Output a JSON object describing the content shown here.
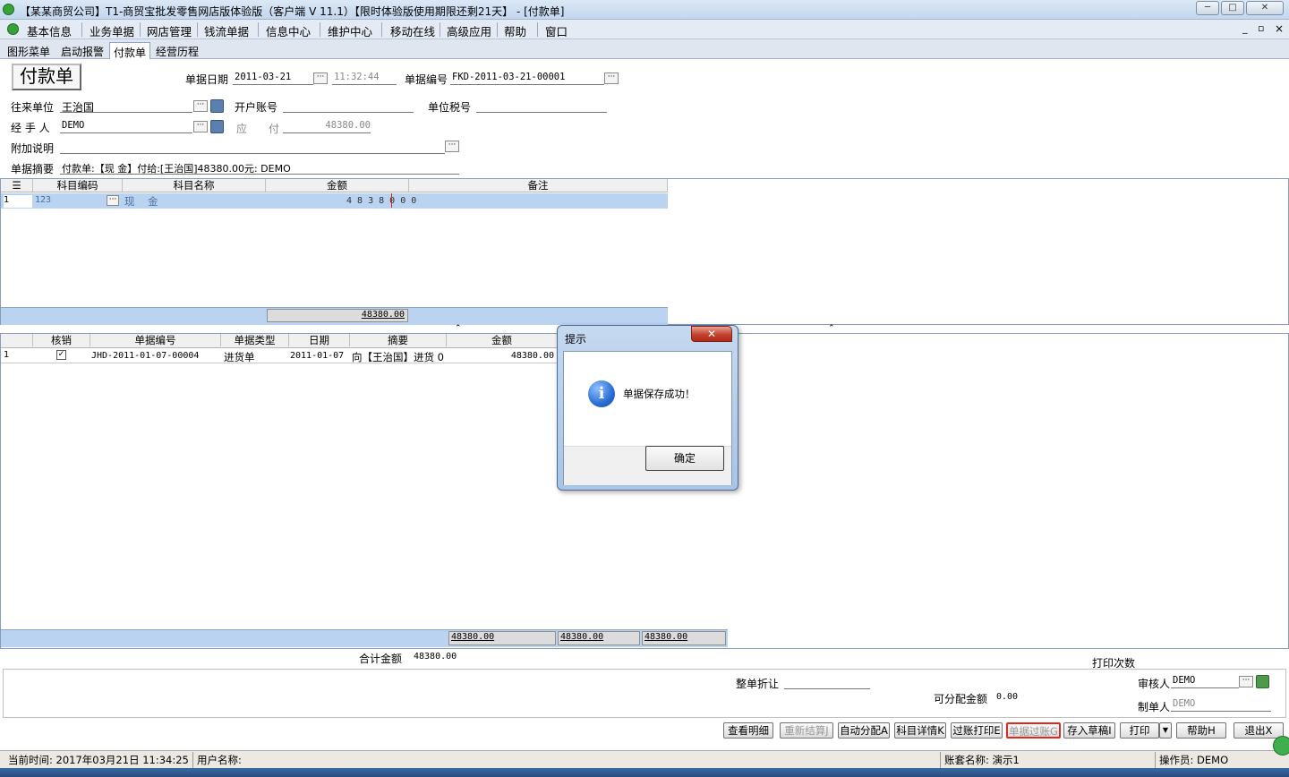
{
  "window": {
    "title": "【某某商贸公司】T1-商贸宝批发零售网店版体验版（客户端 V 11.1）【限时体验版使用期限还剩21天】 - [付款单]",
    "min_glyph": "─",
    "max_glyph": "□",
    "close_glyph": "✕"
  },
  "menubar": {
    "items": [
      "基本信息",
      "业务单据",
      "网店管理",
      "钱流单据",
      "信息中心",
      "维护中心",
      "移动在线",
      "高级应用",
      "帮助",
      "窗口"
    ],
    "right_glyphs": [
      "_",
      "▫",
      "×"
    ]
  },
  "tabs": [
    "图形菜单",
    "启动报警",
    "付款单",
    "经营历程"
  ],
  "active_tab": "付款单",
  "form": {
    "title": "付款单",
    "date_label": "单据日期",
    "date_value": "2011-03-21",
    "time_value": "11:32:44",
    "number_label": "单据编号",
    "number_value": "FKD-2011-03-21-00001",
    "partner_label": "往来单位",
    "partner_value": "王治国",
    "bank_label": "开户账号",
    "bank_value": "",
    "taxno_label": "单位税号",
    "taxno_value": "",
    "handler_label": "经 手 人",
    "handler_value": "DEMO",
    "payable_label_1": "应",
    "payable_label_2": "付",
    "payable_value": "48380.00",
    "note_label": "附加说明",
    "note_value": "",
    "summary_label": "单据摘要",
    "summary_value": "付款单:【现   金】付给:[王治国]48380.00元: DEMO"
  },
  "account_grid": {
    "headers": [
      "科目编码",
      "科目名称",
      "金额",
      "备注"
    ],
    "rows": [
      {
        "no": "1",
        "code": "123",
        "name": "现    金",
        "amount_digits": "4 8 3 8 0 0 0",
        "remark": ""
      }
    ],
    "total": "48380.00"
  },
  "writeoff_grid": {
    "headers": [
      "核销",
      "单据编号",
      "单据类型",
      "日期",
      "摘要",
      "金额"
    ],
    "rows": [
      {
        "no": "1",
        "checked": true,
        "number": "JHD-2011-01-07-00004",
        "type": "进货单",
        "date": "2011-01-07",
        "summary": "向【王治国】进货 0",
        "amount": "48380.00"
      }
    ],
    "totals": [
      "48380.00",
      "48380.00",
      "48380.00"
    ]
  },
  "footer": {
    "total_label": "合计金额",
    "total_value": "48380.00",
    "print_count_label": "打印次数",
    "discount_label": "整单折让",
    "discount_value": "",
    "allocatable_label": "可分配金额",
    "allocatable_value": "0.00",
    "auditor_label": "审核人",
    "auditor_value": "DEMO",
    "maker_label": "制单人",
    "maker_value": "DEMO"
  },
  "buttons": [
    "查看明细",
    "重新结算J",
    "自动分配A",
    "科目详情K",
    "过账打印E",
    "单据过账G",
    "存入草稿I",
    "打印",
    "帮助H",
    "退出X"
  ],
  "dialog": {
    "title": "提示",
    "close_glyph": "✕",
    "icon_glyph": "i",
    "message": "单据保存成功！",
    "ok_label": "确定"
  },
  "status": {
    "time_text": "当前时间: 2017年03月21日 11:34:25",
    "user_label": "用户名称:",
    "account_set": "账套名称: 演示1",
    "operator": "操作员: DEMO"
  },
  "colors": {
    "selection": "#b9d3f1",
    "highlight_border": "#e0281e",
    "menubar": "#e5ebf4"
  }
}
